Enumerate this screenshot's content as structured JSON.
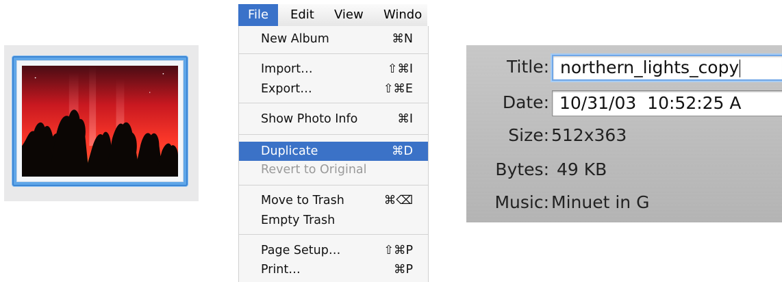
{
  "menu_bar": {
    "items": [
      {
        "label": "File",
        "active": true
      },
      {
        "label": "Edit",
        "active": false
      },
      {
        "label": "View",
        "active": false
      },
      {
        "label": "Windo",
        "active": false
      }
    ]
  },
  "file_menu": {
    "items": [
      {
        "label": "New Album",
        "shortcut": "⌘N"
      },
      {
        "label": "Import…",
        "shortcut": "⇧⌘I"
      },
      {
        "label": "Export…",
        "shortcut": "⇧⌘E"
      },
      {
        "label": "Show Photo Info",
        "shortcut": "⌘I"
      },
      {
        "label": "Duplicate",
        "shortcut": "⌘D",
        "highlighted": true
      },
      {
        "label": "Revert to Original",
        "shortcut": "",
        "disabled": true
      },
      {
        "label": "Move to Trash",
        "shortcut": "⌘⌫"
      },
      {
        "label": "Empty Trash",
        "shortcut": ""
      },
      {
        "label": "Page Setup…",
        "shortcut": "⇧⌘P"
      },
      {
        "label": "Print…",
        "shortcut": "⌘P"
      }
    ]
  },
  "photo_info": {
    "title": {
      "label": "Title:",
      "value": "northern_lights_copy"
    },
    "date": {
      "label": "Date:",
      "value": "10/31/03  10:52:25 A"
    },
    "size": {
      "label": "Size:",
      "value": "512x363"
    },
    "bytes": {
      "label": "Bytes:",
      "value": "49 KB"
    },
    "music": {
      "label": "Music:",
      "value": "Minuet in G"
    }
  },
  "colors": {
    "selection_blue": "#3b72c7",
    "thumb_selection": "#5fa6e8"
  }
}
